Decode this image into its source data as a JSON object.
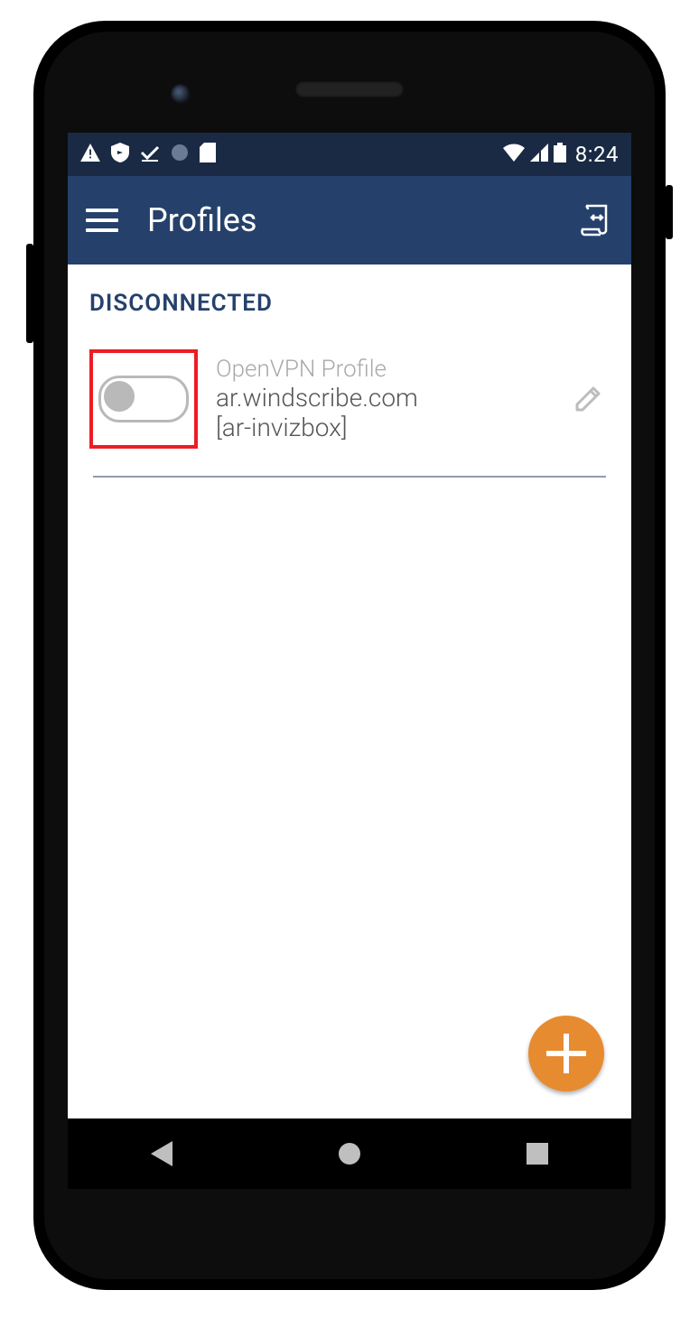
{
  "status_bar": {
    "time": "8:24"
  },
  "app_bar": {
    "title": "Profiles"
  },
  "main": {
    "status_label": "DISCONNECTED",
    "profile": {
      "label": "OpenVPN Profile",
      "line1": "ar.windscribe.com",
      "line2": "[ar-invizbox]"
    }
  }
}
